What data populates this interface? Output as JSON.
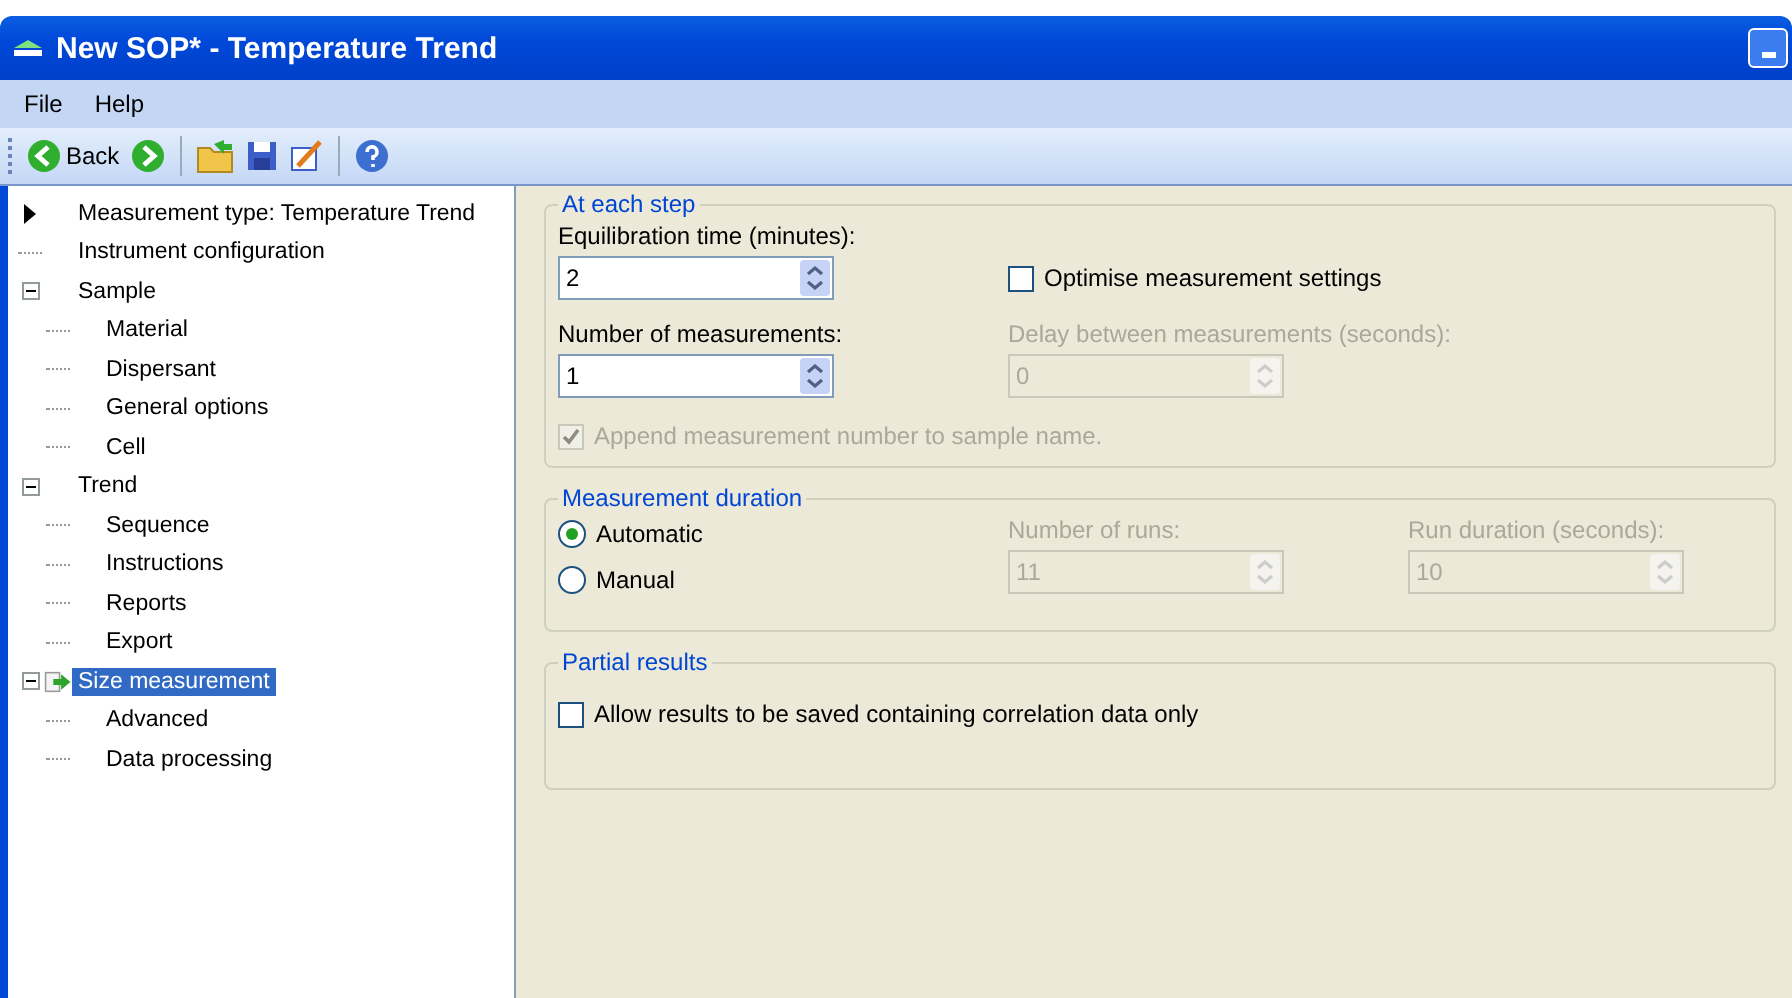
{
  "window": {
    "title": "New SOP* - Temperature Trend"
  },
  "menu": [
    "File",
    "Help"
  ],
  "toolbar": {
    "back_label": "Back"
  },
  "tree": {
    "header": "Measurement type: Temperature Trend",
    "items": [
      {
        "label": "Instrument configuration",
        "selected": false
      },
      {
        "label": "Sample",
        "selected": false,
        "expanded": true,
        "children": [
          {
            "label": "Material",
            "selected": false
          },
          {
            "label": "Dispersant",
            "selected": false
          },
          {
            "label": "General options",
            "selected": false
          },
          {
            "label": "Cell",
            "selected": false
          }
        ]
      },
      {
        "label": "Trend",
        "selected": false,
        "expanded": true,
        "children": [
          {
            "label": "Sequence",
            "selected": false
          },
          {
            "label": "Instructions",
            "selected": false
          },
          {
            "label": "Reports",
            "selected": false
          },
          {
            "label": "Export",
            "selected": false
          }
        ]
      },
      {
        "label": "Size measurement",
        "selected": true,
        "expanded": true,
        "children": [
          {
            "label": "Advanced",
            "selected": false
          },
          {
            "label": "Data processing",
            "selected": false
          }
        ]
      }
    ]
  },
  "at_each_step": {
    "title": "At each step",
    "equilibration": {
      "label": "Equilibration time (minutes):",
      "value": "2",
      "disabled": false
    },
    "optimise": {
      "label": "Optimise measurement settings",
      "checked": false,
      "disabled": false
    },
    "number_of_measurements": {
      "label": "Number of measurements:",
      "value": "1",
      "disabled": false
    },
    "delay": {
      "label": "Delay between measurements (seconds):",
      "value": "0",
      "disabled": true
    },
    "append": {
      "label": "Append measurement number to sample name.",
      "checked": true,
      "disabled": true
    }
  },
  "measurement_duration": {
    "title": "Measurement duration",
    "modes": [
      {
        "label": "Automatic",
        "selected": true
      },
      {
        "label": "Manual",
        "selected": false
      }
    ],
    "number_of_runs": {
      "label": "Number of runs:",
      "value": "11",
      "disabled": true
    },
    "run_duration": {
      "label": "Run duration (seconds):",
      "value": "10",
      "disabled": true
    }
  },
  "partial_results": {
    "title": "Partial results",
    "allow": {
      "label": "Allow results to be saved containing correlation data only",
      "checked": false,
      "disabled": false
    }
  }
}
